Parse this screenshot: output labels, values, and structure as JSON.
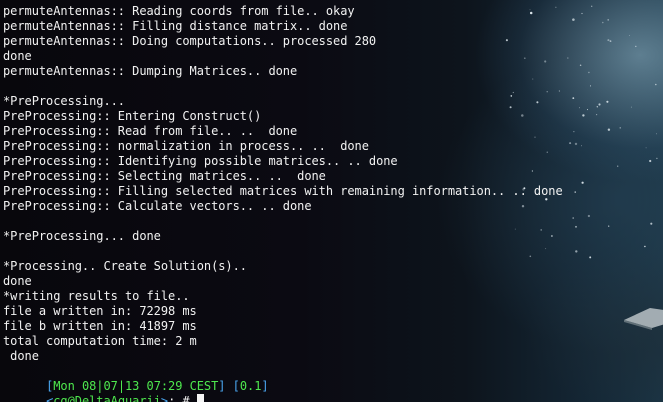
{
  "output_lines": [
    "permuteAntennas:: Reading coords from file.. okay",
    "permuteAntennas:: Filling distance matrix.. done",
    "permuteAntennas:: Doing computations.. processed 280",
    "done",
    "permuteAntennas:: Dumping Matrices.. done",
    "",
    "*PreProcessing...",
    "PreProcessing:: Entering Construct()",
    "PreProcessing:: Read from file.. ..  done",
    "PreProcessing:: normalization in process.. ..  done",
    "PreProcessing:: Identifying possible matrices.. .. done",
    "PreProcessing:: Selecting matrices.. ..  done",
    "PreProcessing:: Filling selected matrices with remaining information.. .. done",
    "PreProcessing:: Calculate vectors.. .. done",
    "",
    "*PreProcessing... done",
    "",
    "*Processing.. Create Solution(s)..",
    "done",
    "*writing results to file..",
    "file a written in: 72298 ms",
    "file b written in: 41897 ms",
    "total computation time: 2 m",
    " done"
  ],
  "status_line": {
    "open_bracket": "[",
    "date_time": "Mon 08|07|13 07:29 CEST",
    "close_bracket": "]",
    "separator": " ",
    "version_open": "[",
    "version": "0.1",
    "version_close": "]"
  },
  "prompt": {
    "open": "<",
    "user_host": "cg@DeltaAquarii",
    "close": ">",
    "symbol": ": #"
  },
  "colors": {
    "text": "#f2f2f2",
    "green": "#4ee84e",
    "blue": "#4aa6f0",
    "background": "#0a0a10"
  }
}
